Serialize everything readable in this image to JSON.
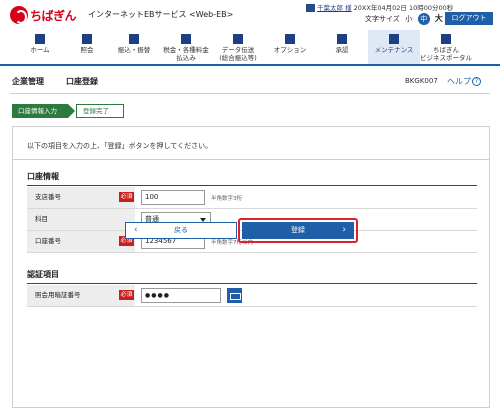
{
  "header": {
    "logo_text": "ちばぎん",
    "service_name": "インターネットEBサービス <Web-EB>",
    "user_name": "千葉太郎 様",
    "datetime": "20XX年04月02日 10時00分00秒",
    "font_size_label": "文字サイズ",
    "font_small": "小",
    "font_medium": "中",
    "font_large": "大",
    "logout": "ログアウト"
  },
  "nav": [
    {
      "label": "ホーム",
      "icon": "home-icon"
    },
    {
      "label": "照会",
      "icon": "inquiry-icon"
    },
    {
      "label": "振込・振替",
      "icon": "transfer-icon"
    },
    {
      "label": "税金・各種料金\n払込み",
      "icon": "tax-payment-icon"
    },
    {
      "label": "データ伝送\n(総合振込等)",
      "icon": "data-transfer-icon"
    },
    {
      "label": "オプション",
      "icon": "option-icon"
    },
    {
      "label": "承認",
      "icon": "approval-icon"
    },
    {
      "label": "メンテナンス",
      "icon": "maintenance-icon"
    },
    {
      "label": "ちばぎん\nビジネスポータル",
      "icon": "portal-icon"
    }
  ],
  "title": {
    "main": "企業管理",
    "sub": "口座登録",
    "screen_id": "BKGK007",
    "help": "ヘルプ"
  },
  "steps": [
    "口座情報入力",
    "登録完了"
  ],
  "instruction": "以下の項目を入力の上、「登録」ボタンを押してください。",
  "sections": {
    "account_info": "口座情報",
    "auth": "認証項目"
  },
  "fields": {
    "branch": {
      "label": "支店番号",
      "required": "必須",
      "value": "100",
      "hint": "半角数字3桁"
    },
    "subject": {
      "label": "科目",
      "value": "普通"
    },
    "account": {
      "label": "口座番号",
      "required": "必須",
      "value": "1234567",
      "hint": "半角数字7桁以内"
    },
    "pin": {
      "label": "照会用暗証番号",
      "required": "必須",
      "value": "●●●●"
    }
  },
  "buttons": {
    "back": "戻る",
    "submit": "登録"
  },
  "colors": {
    "brand_red": "#d9001b",
    "nav_blue": "#1f5fa8",
    "step_green": "#2c7a3e",
    "highlight_red": "#e0202a"
  }
}
